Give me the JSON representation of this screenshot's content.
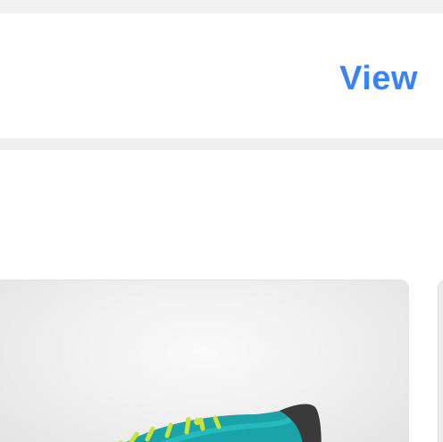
{
  "header": {
    "view_label": "View"
  },
  "colors": {
    "link": "#3b82f6",
    "shoe_upper": "#1aa3a8",
    "shoe_laces": "#c8e43a",
    "shoe_sole": "#3a3a3a"
  },
  "products": [
    {
      "image": "shoe-icon"
    },
    {
      "image": "product-image-partial"
    }
  ]
}
